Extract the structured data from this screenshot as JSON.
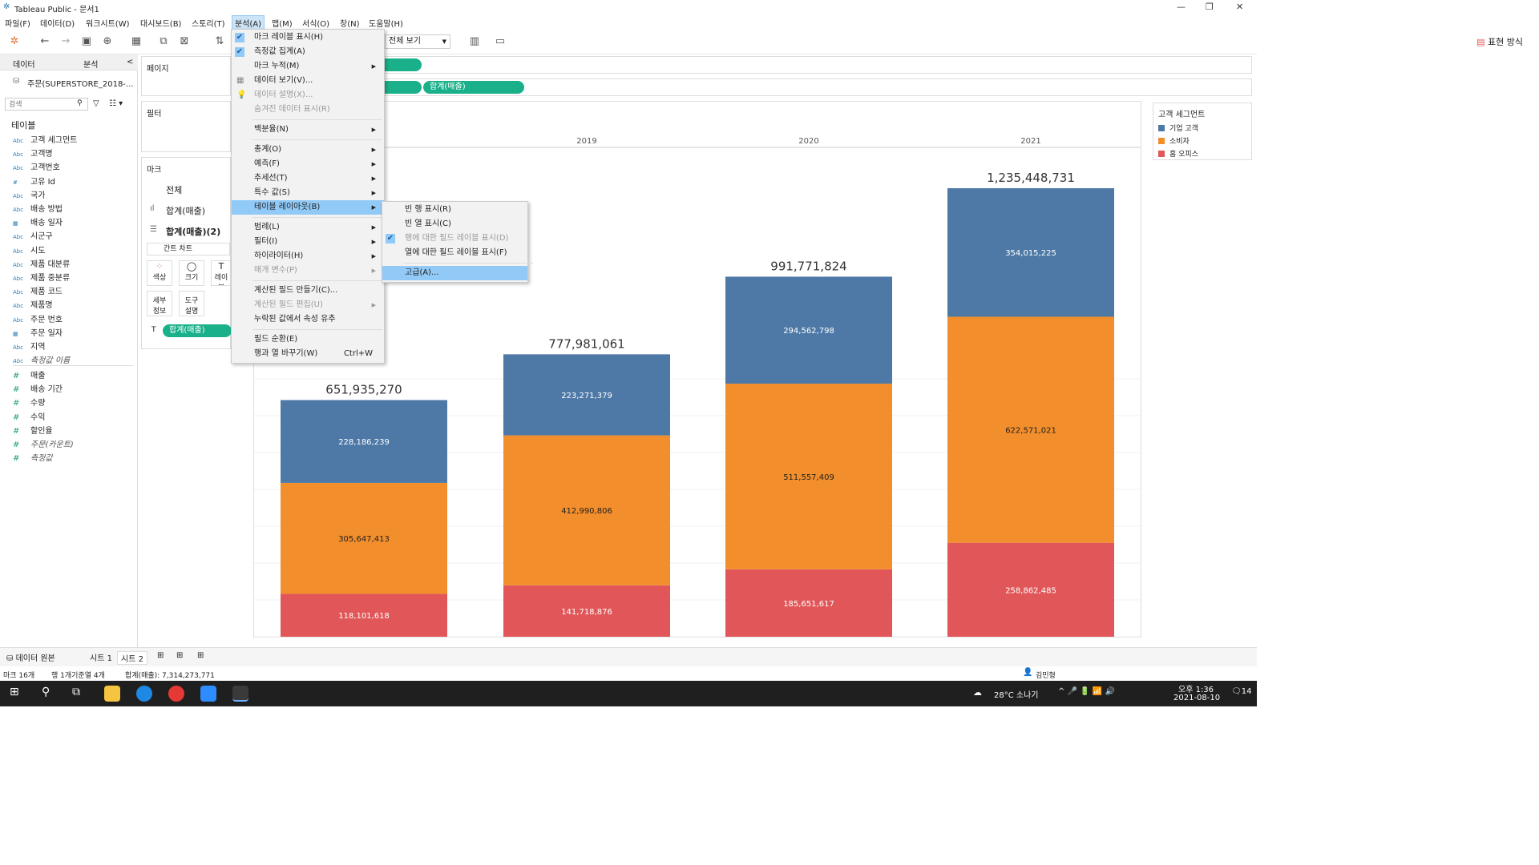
{
  "title": "Tableau Public - 문서1",
  "window_controls": [
    "—",
    "❐",
    "✕"
  ],
  "menu": [
    "파일(F)",
    "데이터(D)",
    "워크시트(W)",
    "대시보드(B)",
    "스토리(T)",
    "분석(A)",
    "맵(M)",
    "서식(O)",
    "창(N)",
    "도움말(H)"
  ],
  "toolbar": {
    "view_select": "전체 보기",
    "show_me": "표현 방식"
  },
  "left_panel": {
    "tab_data": "데이터",
    "tab_analysis": "분석",
    "datasource": "주문(SUPERSTORE_2018-...",
    "search_placeholder": "검색",
    "section": "테이블",
    "dims": [
      {
        "t": "Abc",
        "n": "고객 세그먼트"
      },
      {
        "t": "Abc",
        "n": "고객명"
      },
      {
        "t": "Abc",
        "n": "고객번호"
      },
      {
        "t": "#",
        "n": "고유 Id"
      },
      {
        "t": "Abc",
        "n": "국가"
      },
      {
        "t": "Abc",
        "n": "배송 방법"
      },
      {
        "t": "cal",
        "n": "배송 일자"
      },
      {
        "t": "Abc",
        "n": "시군구"
      },
      {
        "t": "Abc",
        "n": "시도"
      },
      {
        "t": "Abc",
        "n": "제품 대분류"
      },
      {
        "t": "Abc",
        "n": "제품 중분류"
      },
      {
        "t": "Abc",
        "n": "제품 코드"
      },
      {
        "t": "Abc",
        "n": "제품명"
      },
      {
        "t": "Abc",
        "n": "주문 번호"
      },
      {
        "t": "cal",
        "n": "주문 일자"
      },
      {
        "t": "Abc",
        "n": "지역"
      },
      {
        "t": "Abc",
        "n": "측정값 이름",
        "it": true
      }
    ],
    "measures": [
      {
        "n": "매출"
      },
      {
        "n": "배송 기간"
      },
      {
        "n": "수량"
      },
      {
        "n": "수익"
      },
      {
        "n": "할인율"
      },
      {
        "n": "주문(카운트)",
        "it": true
      },
      {
        "n": "측정값",
        "it": true
      }
    ]
  },
  "shelves": {
    "pages": "페이지",
    "filters": "필터",
    "marks": "마크",
    "marks_all": "전체",
    "marks_m1": "합계(매출)",
    "marks_m2": "합계(매출)(2)",
    "mark_type": "간트 차트",
    "color": "색상",
    "size": "크기",
    "label": "레이블",
    "detail": "세부\n정보",
    "tooltip": "도구\n설명",
    "label_pill": "합계(매출)"
  },
  "rows_pill": "합계(매출)",
  "analysis_menu": [
    {
      "label": "마크 레이블 표시(H)",
      "check": true
    },
    {
      "label": "측정값 집계(A)",
      "check": true
    },
    {
      "label": "마크 누적(M)",
      "arrow": true
    },
    {
      "label": "데이터 보기(V)...",
      "icon": "grid"
    },
    {
      "label": "데이터 설명(X)...",
      "dis": true,
      "icon": "bulb"
    },
    {
      "label": "숨겨진 데이터 표시(R)",
      "dis": true
    },
    {
      "sep": true
    },
    {
      "label": "백분율(N)",
      "arrow": true
    },
    {
      "sep": true
    },
    {
      "label": "총계(O)",
      "arrow": true
    },
    {
      "label": "예측(F)",
      "arrow": true
    },
    {
      "label": "추세선(T)",
      "arrow": true
    },
    {
      "label": "특수 값(S)",
      "arrow": true
    },
    {
      "label": "테이블 레이아웃(B)",
      "arrow": true,
      "hl": true
    },
    {
      "sep": true
    },
    {
      "label": "범례(L)",
      "arrow": true
    },
    {
      "label": "필터(I)",
      "arrow": true
    },
    {
      "label": "하이라이터(H)",
      "arrow": true
    },
    {
      "label": "매개 변수(P)",
      "arrow": true,
      "dis": true
    },
    {
      "sep": true
    },
    {
      "label": "계산된 필드 만들기(C)..."
    },
    {
      "label": "계산된 필드 편집(U)",
      "arrow": true,
      "dis": true
    },
    {
      "label": "누락된 값에서 속성 유추"
    },
    {
      "sep": true
    },
    {
      "label": "필드 순환(E)"
    },
    {
      "label": "행과 열 바꾸기(W)",
      "shortcut": "Ctrl+W"
    }
  ],
  "table_layout_submenu": [
    {
      "label": "빈 행 표시(R)"
    },
    {
      "label": "빈 열 표시(C)"
    },
    {
      "label": "행에 대한 필드 레이블 표시(D)",
      "dis": true,
      "check": true
    },
    {
      "label": "열에 대한 필드 레이블 표시(F)"
    },
    {
      "sep": true
    },
    {
      "label": "고급(A)...",
      "hl": true
    }
  ],
  "legend": {
    "title": "고객 세그먼트",
    "items": [
      {
        "name": "기업 고객",
        "color": "#4e79a7"
      },
      {
        "name": "소비자",
        "color": "#f28e2b"
      },
      {
        "name": "홈 오피스",
        "color": "#e15759"
      }
    ]
  },
  "chart_data": {
    "type": "bar",
    "stacked": true,
    "categories": [
      "2019",
      "2020",
      "2021"
    ],
    "extra_bar_left": {
      "label": "",
      "values": [
        118101618,
        305647413,
        228186239
      ],
      "total": "651,935,270"
    },
    "series": [
      {
        "name": "홈 오피스",
        "values": [
          141718876,
          185651617,
          258862485
        ],
        "labels": [
          "141,718,876",
          "185,651,617",
          "258,862,485"
        ]
      },
      {
        "name": "소비자",
        "values": [
          412990806,
          511557409,
          622571021
        ],
        "labels": [
          "412,990,806",
          "511,557,409",
          "622,571,021"
        ]
      },
      {
        "name": "기업 고객",
        "values": [
          223271379,
          294562798,
          354015225
        ],
        "labels": [
          "223,271,379",
          "294,562,798",
          "354,015,225"
        ]
      }
    ],
    "first_bar_labels": [
      "118,101,618",
      "305,647,413",
      "228,186,239"
    ],
    "totals": [
      "777,981,061",
      "991,771,824",
      "1,235,448,731"
    ],
    "colors": [
      "#e15759",
      "#f28e2b",
      "#4e79a7"
    ]
  },
  "bottom": {
    "datasource_tab": "데이터 원본",
    "sheet1": "시트 1",
    "sheet2": "시트 2"
  },
  "status": {
    "marks": "마크 16개",
    "rows": "행 1개기준열 4개",
    "sum": "합계(매출): 7,314,273,771",
    "user": "김민형"
  },
  "taskbar": {
    "weather": "28°C 소나기",
    "time": "오후 1:36",
    "date": "2021-08-10",
    "notif": "14"
  }
}
